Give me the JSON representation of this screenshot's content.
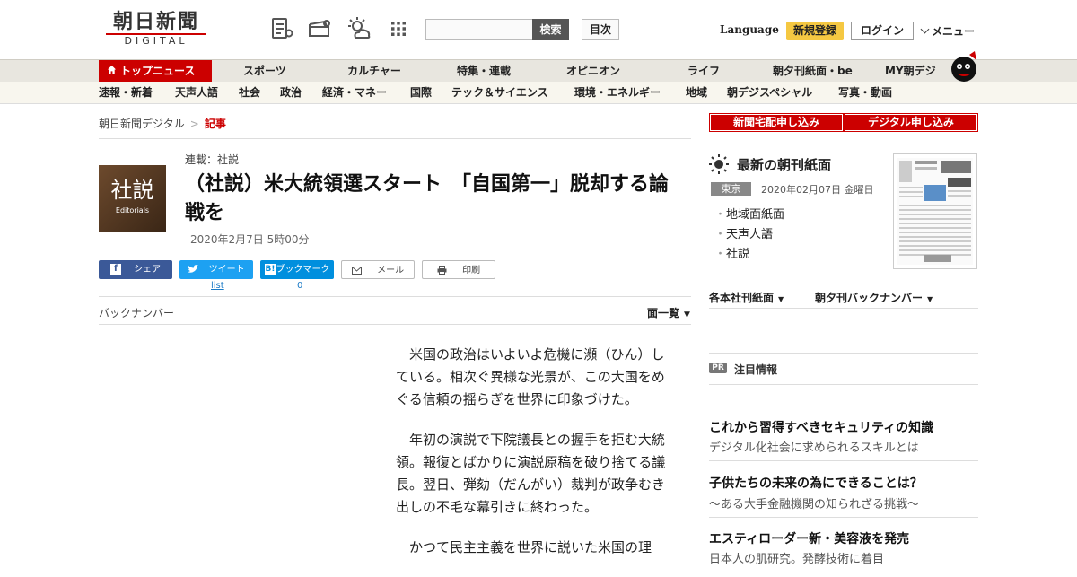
{
  "header": {
    "logo_main": "朝日新聞",
    "logo_sub": "DIGITAL",
    "search_button": "検索",
    "toc_button": "目次",
    "language": "Language",
    "register": "新規登録",
    "login": "ログイン",
    "menu": "メニュー"
  },
  "nav_primary": {
    "top": "トップニュース",
    "items": [
      "スポーツ",
      "カルチャー",
      "特集・連載",
      "オピニオン",
      "ライフ",
      "朝夕刊紙面・be",
      "MY朝デジ"
    ]
  },
  "nav_secondary": {
    "items": [
      "速報・新着",
      "天声人語",
      "社会",
      "政治",
      "経済・マネー",
      "国際",
      "テック＆サイエンス",
      "環境・エネルギー",
      "地域",
      "朝デジスペシャル",
      "写真・動画"
    ]
  },
  "breadcrumb": {
    "home": "朝日新聞デジタル",
    "sep": ">",
    "current": "記事"
  },
  "article": {
    "badge_kanji": "社説",
    "badge_en": "Editorials",
    "series": "連載：社説",
    "title": "（社説）米大統領選スタート　「自国第一」脱却する論戦を",
    "date": "2020年2月7日 5時00分",
    "share": {
      "facebook": "シェア",
      "twitter": "ツイート",
      "twitter_count": "list",
      "hatena": "ブックマーク",
      "hatena_count": "0",
      "mail": "メール",
      "print": "印刷"
    },
    "back_number": "バックナンバー",
    "page_list": "面一覧",
    "paragraphs": [
      "米国の政治はいよいよ危機に瀕（ひん）している。相次ぐ異様な光景が、この大国をめぐる信頼の揺らぎを世界に印象づけた。",
      "年初の演説で下院議長との握手を拒む大統領。報復とばかりに演説原稿を破り捨てる議長。翌日、弾劾（だんがい）裁判が政争むき出しの不毛な幕引きに終わった。",
      "かつて民主主義を世界に説いた米国の理"
    ]
  },
  "sidebar": {
    "btn_home_delivery": "新聞宅配申し込み",
    "btn_digital": "デジタル申し込み",
    "latest_head": "最新の朝刊紙面",
    "region_tag": "東京",
    "latest_date": "2020年02月07日 金曜日",
    "links": [
      "地域面紙面",
      "天声人語",
      "社説"
    ],
    "sec_main": "本社刊紙面",
    "sec_main_prefix": "各",
    "sec_back": "朝夕刊バックナンバー",
    "pr_badge": "PR",
    "pr_head": "注目情報",
    "ads": [
      {
        "title": "これから習得すべきセキュリティの知識",
        "sub": "デジタル化社会に求められるスキルとは"
      },
      {
        "title": "子供たちの未来の為にできることは？",
        "sub": "～ある大手金融機関の知られざる挑戦～"
      },
      {
        "title": "エスティローダー新・美容液を発売",
        "sub": "日本人の肌研究。発酵技術に着目"
      }
    ]
  },
  "colors": {
    "brand_red": "#cc0000",
    "register_yellow": "#f5c842",
    "facebook": "#3b5998",
    "twitter": "#1da1f2",
    "hatena": "#008fde"
  }
}
